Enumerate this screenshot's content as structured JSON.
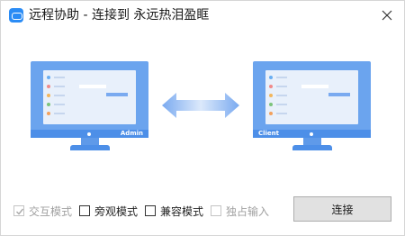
{
  "window": {
    "title": "远程协助 - 连接到 永远热泪盈眶",
    "icon": "teamviewer-icon",
    "accent": "#2b8cf5"
  },
  "illustration": {
    "host_label": "Admin",
    "client_label": "Client",
    "monitor_color": "#6ba4ee",
    "arrow_color": "#8fbaf4",
    "bullet_colors": [
      "#6aaef2",
      "#f08a8a",
      "#f3b65c",
      "#7cc47c",
      "#f3a15c"
    ]
  },
  "options": [
    {
      "label": "交互模式",
      "checked": true,
      "enabled": false
    },
    {
      "label": "旁观模式",
      "checked": false,
      "enabled": true
    },
    {
      "label": "兼容模式",
      "checked": false,
      "enabled": true
    },
    {
      "label": "独占输入",
      "checked": false,
      "enabled": false
    }
  ],
  "connect_button": {
    "label": "连接"
  }
}
